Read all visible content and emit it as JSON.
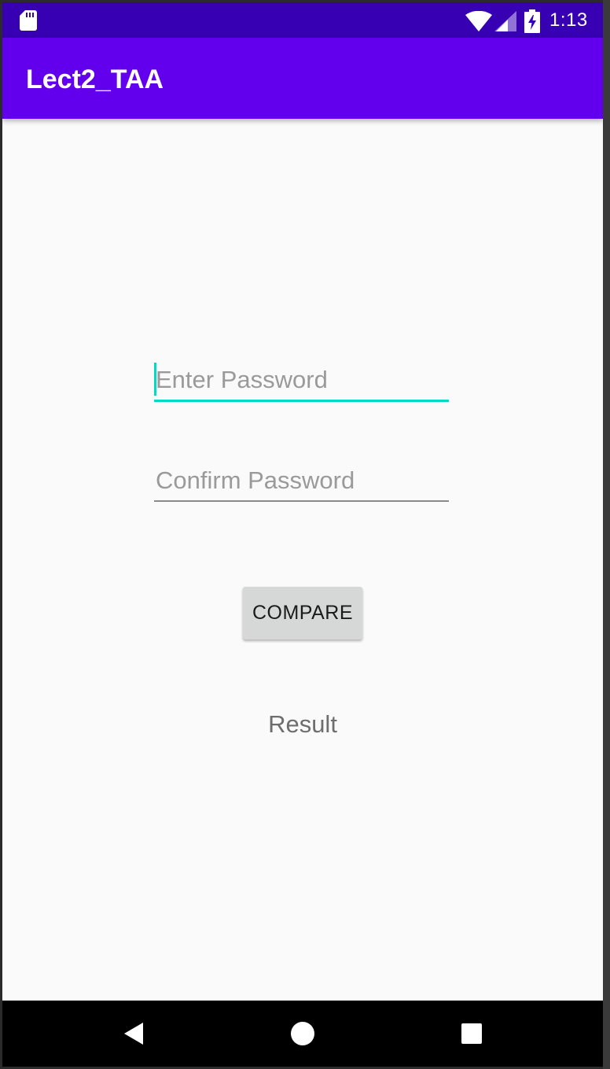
{
  "status_bar": {
    "time": "1:13",
    "background": "#3700b3",
    "icons": [
      "sd-card-icon",
      "wifi-icon",
      "signal-icon",
      "battery-charging-icon"
    ]
  },
  "app_bar": {
    "title": "Lect2_TAA",
    "background": "#6200ee"
  },
  "form": {
    "password_placeholder": "Enter Password",
    "confirm_placeholder": "Confirm Password",
    "password_value": "",
    "confirm_value": "",
    "accent_color": "#03dac5",
    "compare_label": "COMPARE",
    "result_text": "Result"
  },
  "nav_bar": {
    "buttons": [
      "back-icon",
      "home-icon",
      "recents-icon"
    ]
  }
}
